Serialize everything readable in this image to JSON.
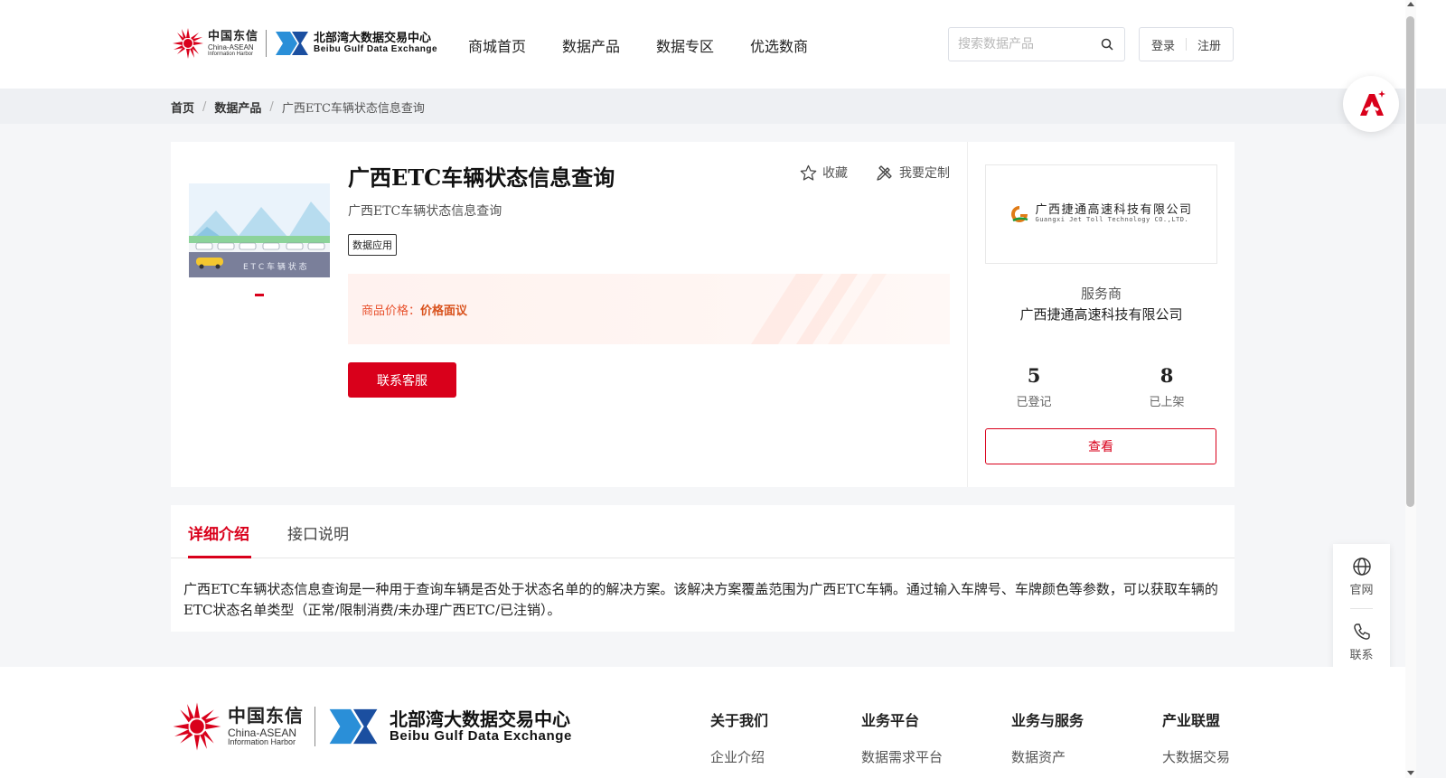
{
  "header": {
    "logo_cd": {
      "cn": "中国东信",
      "en1": "China-ASEAN",
      "en2": "Information Harbor"
    },
    "logo_bg": {
      "cn": "北部湾大数据交易中心",
      "en": "Beibu Gulf Data Exchange"
    },
    "nav": [
      "商城首页",
      "数据产品",
      "数据专区",
      "优选数商"
    ],
    "search_placeholder": "搜索数据产品",
    "login": "登录",
    "register": "注册"
  },
  "breadcrumb": {
    "home": "首页",
    "products": "数据产品",
    "current": "广西ETC车辆状态信息查询"
  },
  "product": {
    "title": "广西ETC车辆状态信息查询",
    "subtitle": "广西ETC车辆状态信息查询",
    "tag": "数据应用",
    "favorite": "收藏",
    "customize": "我要定制",
    "price_label": "商品价格：",
    "price_value": "价格面议",
    "contact_button": "联系客服",
    "thumb_text": "E T C 车 辆 状 态"
  },
  "vendor": {
    "logo_cn": "广西捷通高速科技有限公司",
    "logo_en": "Guangxi Jet Toll Technology CO.,LTD.",
    "label": "服务商",
    "name": "广西捷通高速科技有限公司",
    "stats": [
      {
        "num": "5",
        "label": "已登记"
      },
      {
        "num": "8",
        "label": "已上架"
      }
    ],
    "view_button": "查看"
  },
  "tabs": [
    {
      "label": "详细介绍",
      "active": true
    },
    {
      "label": "接口说明",
      "active": false
    }
  ],
  "description": "广西ETC车辆状态信息查询是一种用于查询车辆是否处于状态名单的的解决方案。该解决方案覆盖范围为广西ETC车辆。通过输入车牌号、车牌颜色等参数，可以获取车辆的ETC状态名单类型（正常/限制消费/未办理广西ETC/已注销）。",
  "side_float": {
    "website": "官网",
    "contact": "联系"
  },
  "footer": {
    "columns": [
      {
        "title": "关于我们",
        "link": "企业介绍"
      },
      {
        "title": "业务平台",
        "link": "数据需求平台"
      },
      {
        "title": "业务与服务",
        "link": "数据资产"
      },
      {
        "title": "产业联盟",
        "link": "大数据交易"
      }
    ]
  },
  "colors": {
    "brand_red": "#d9001b",
    "price_orange": "#e8522e"
  }
}
